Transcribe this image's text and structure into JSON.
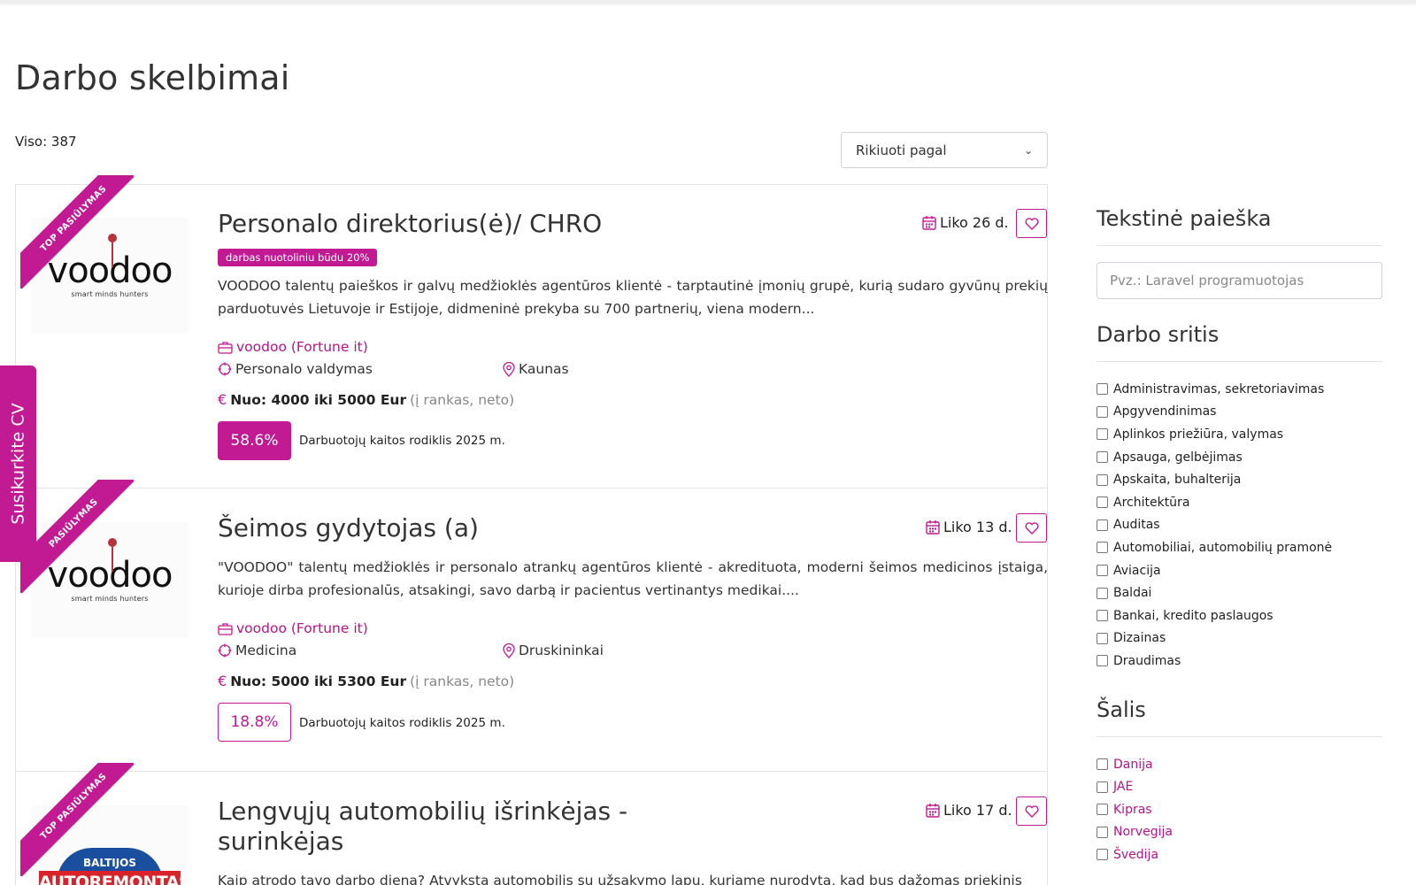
{
  "header": {
    "title": "Darbo skelbimai"
  },
  "listing": {
    "total_label": "Viso: 387",
    "sort_label": "Rikiuoti pagal"
  },
  "side_tab": {
    "label": "Susikurkite CV"
  },
  "jobs": [
    {
      "ribbon": "TOP PASIŪLYMAS",
      "logo_text": "voodoo",
      "logo_sub": "smart minds hunters",
      "title": "Personalo direktorius(ė)/ CHRO",
      "remote_badge": "darbas nuotoliniu būdu 20%",
      "description": "VOODOO talentų paieškos ir galvų medžioklės agentūros klientė - tarptautinė įmonių grupė, kurią sudaro gyvūnų prekių parduotuvės Lietuvoje ir Estijoje, didmeninė prekyba su 700 partnerių, viena modern...",
      "company": "voodoo (Fortune it)",
      "category": "Personalo valdymas",
      "city": "Kaunas",
      "salary": "Nuo: 4000 iki 5000 Eur",
      "salary_note": "(į rankas, neto)",
      "rate": "58.6%",
      "rate_label": "Darbuotojų kaitos rodiklis 2025 m.",
      "deadline": "Liko 26 d."
    },
    {
      "ribbon": "PASIŪLYMAS",
      "logo_text": "voodoo",
      "logo_sub": "smart minds hunters",
      "title": "Šeimos gydytojas (a)",
      "description": "\"VOODOO\" talentų medžioklės ir personalo atrankų agentūros klientė - akredituota, moderni šeimos medicinos įstaiga, kurioje dirba profesionalūs, atsakingi, savo darbą ir pacientus vertinantys medikai....",
      "company": "voodoo (Fortune it)",
      "category": "Medicina",
      "city": "Druskininkai",
      "salary": "Nuo: 5000 iki 5300 Eur",
      "salary_note": "(į rankas, neto)",
      "rate": "18.8%",
      "rate_label": "Darbuotojų kaitos rodiklis 2025 m.",
      "deadline": "Liko 13 d."
    },
    {
      "ribbon": "TOP PASIŪLYMAS",
      "logo_text_top": "BALTIJOS",
      "logo_text": "AUTOREMONTAS",
      "title": "Lengvųjų automobilių išrinkėjas - surinkėjas",
      "description": "Kaip atrodo tavo darbo diena? Atvyksta automobilis su užsakymo lapu, kuriame nurodyta, kad bus dažomas priekinis",
      "deadline": "Liko 17 d."
    }
  ],
  "sidebar": {
    "text_search_title": "Tekstinė paieška",
    "text_search_placeholder": "Pvz.: Laravel programuotojas",
    "area_title": "Darbo sritis",
    "areas": [
      "Administravimas, sekretoriavimas",
      "Apgyvendinimas",
      "Aplinkos priežiūra, valymas",
      "Apsauga, gelbėjimas",
      "Apskaita, buhalterija",
      "Architektūra",
      "Auditas",
      "Automobiliai, automobilių pramonė",
      "Aviacija",
      "Baldai",
      "Bankai, kredito paslaugos",
      "Dizainas",
      "Draudimas"
    ],
    "country_title": "Šalis",
    "countries": [
      "Danija",
      "JAE",
      "Kipras",
      "Norvegija",
      "Švedija"
    ]
  },
  "colors": {
    "accent": "#c11a93",
    "link": "#b31486"
  }
}
